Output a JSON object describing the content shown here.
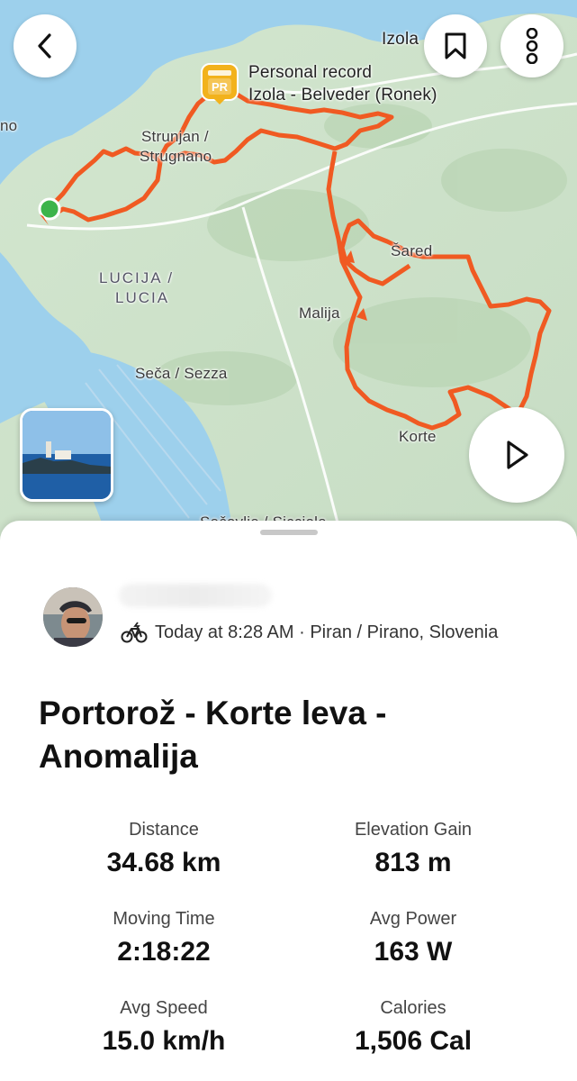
{
  "map": {
    "labels": {
      "izola": "Izola",
      "pr_line1": "Personal record",
      "pr_line2": "Izola - Belveder (Ronek)",
      "strunjan_1": "Strunjan /",
      "strunjan_2": "Strugnano",
      "lucija_1": "LUCIJA /",
      "lucija_2": "LUCIA",
      "sared": "Šared",
      "malija": "Malija",
      "seca": "Seča / Sezza",
      "korte": "Korte",
      "secovlje": "Sečovlje / Sicciole",
      "edge_no": "no",
      "pr_badge": "PR"
    },
    "icons": {
      "back": "chevron-left-icon",
      "bookmark": "bookmark-icon",
      "more": "more-vertical-icon",
      "play": "play-icon"
    },
    "route_color": "#f05a22",
    "start_color": "#3cb44b"
  },
  "activity": {
    "meta": "Today at 8:28 AM · Piran / Pirano, Slovenia",
    "sport_icon": "e-bike-icon",
    "title": "Portorož - Korte leva - Anomalija"
  },
  "stats": [
    {
      "label": "Distance",
      "value": "34.68 km"
    },
    {
      "label": "Elevation Gain",
      "value": "813 m"
    },
    {
      "label": "Moving Time",
      "value": "2:18:22"
    },
    {
      "label": "Avg Power",
      "value": "163 W"
    },
    {
      "label": "Avg Speed",
      "value": "15.0 km/h"
    },
    {
      "label": "Calories",
      "value": "1,506 Cal"
    }
  ]
}
